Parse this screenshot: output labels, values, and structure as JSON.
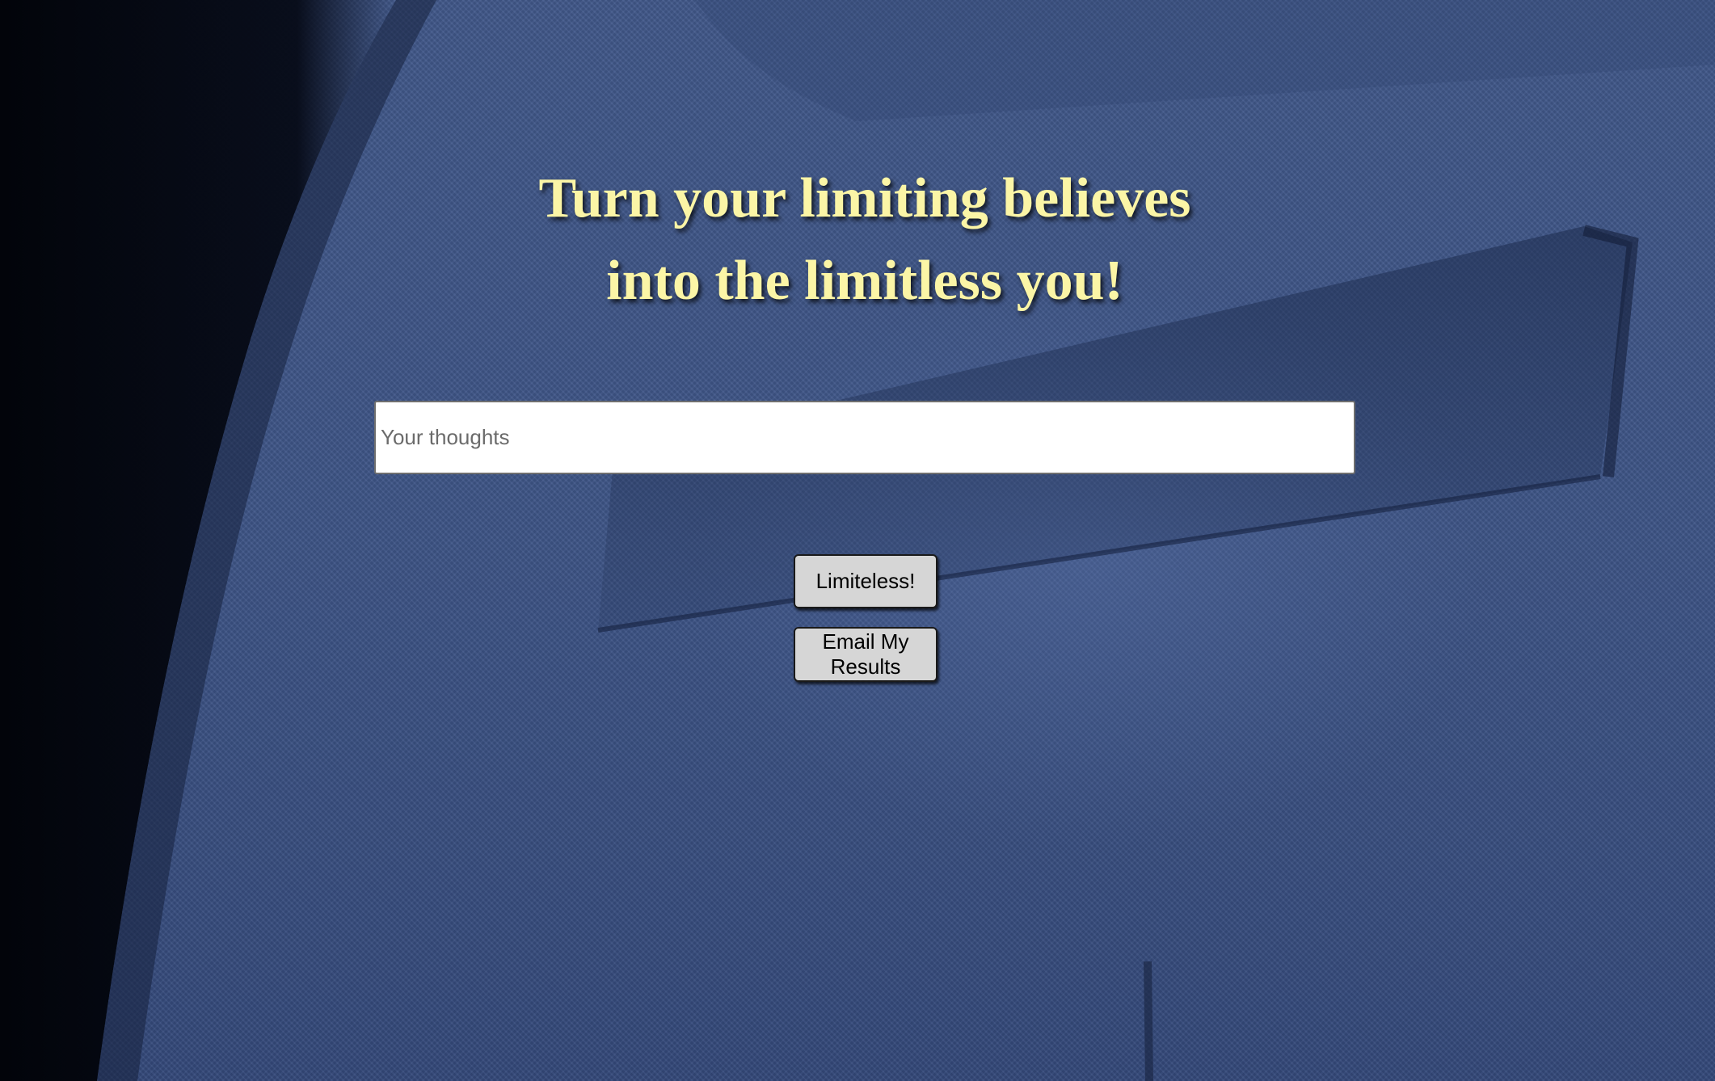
{
  "hero": {
    "headline_line1": "Turn your limiting believes",
    "headline_line2": "into the limitless you!"
  },
  "form": {
    "thoughts_placeholder": "Your thoughts",
    "thoughts_value": ""
  },
  "actions": {
    "limiteless_label": "Limiteless!",
    "email_label": "Email My Results"
  },
  "colors": {
    "headline": "#fbf5a6",
    "background": "#3e5587",
    "button": "#d6d6d6"
  }
}
